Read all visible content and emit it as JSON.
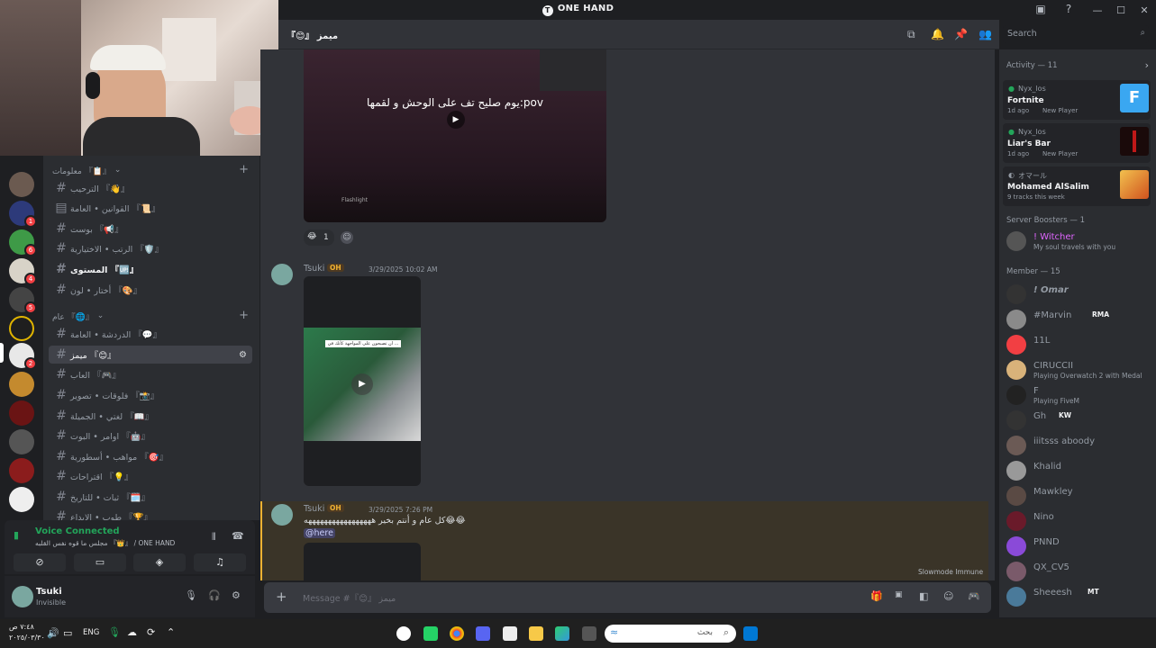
{
  "window": {
    "title": "ONE HAND",
    "controls": [
      "—",
      "☐",
      "✕"
    ]
  },
  "header": {
    "channel": "『😊』 ميمز",
    "search_placeholder": "Search"
  },
  "server_badges": [
    "1",
    "6",
    "4",
    "5",
    "2"
  ],
  "sidebar": {
    "categories": [
      {
        "label": "معلومات 『📋』"
      },
      {
        "label": "عام 『🌐』"
      }
    ],
    "channels": [
      {
        "label": "الترحيب 『👋』"
      },
      {
        "label": "القوانين • العامة 『📜』"
      },
      {
        "label": "بوست 『📢』"
      },
      {
        "label": "الرتب • الاختيارية 『🛡️』"
      },
      {
        "label": "المستوى 『🆙』"
      },
      {
        "label": "أختار • لون 『🎨』"
      },
      {
        "label": "الدردشة • العامة 『💬』"
      },
      {
        "label": "ميمز 『😊』"
      },
      {
        "label": "العاب 『🎮』"
      },
      {
        "label": "فلوقات • تصوير 『📸』"
      },
      {
        "label": "لغتي • الجميلة 『📖』"
      },
      {
        "label": "اوامر • البوت 『🤖』"
      },
      {
        "label": "مواهب • أسطورية 『🎯』"
      },
      {
        "label": "اقتراحات 『💡』"
      },
      {
        "label": "ثبات • للتاريخ 『🗓️』"
      },
      {
        "label": "طوب • الابداع 『🏆』"
      }
    ]
  },
  "voice": {
    "status": "Voice Connected",
    "location": "مجلس ما قوه نفس القلبه 『👑』 / ONE HAND"
  },
  "user": {
    "name": "Tsuki",
    "status": "Invisible"
  },
  "messages": [
    {
      "video_caption": "يوم صليح تف على الوحش و لقمها:pov",
      "video_small": "Flashlight",
      "reaction_count": "1"
    },
    {
      "author": "Tsuki",
      "tag": "OH",
      "timestamp": "3/29/2025 10:02 AM",
      "video_caption": "ان تصبحون على المواجهة كأنك في ..."
    },
    {
      "author": "Tsuki",
      "tag": "OH",
      "timestamp": "3/29/2025 7:26 PM",
      "text": "كل عام و أنتم بخير هههههههههههههههههه😂😂",
      "mention": "@here"
    }
  ],
  "slowmode": "Slowmode Immune",
  "input_placeholder": "Message #『😊』 ميمز",
  "activity": {
    "title": "Activity — 11",
    "items": [
      {
        "user": "Nyx_los",
        "game": "Fortnite",
        "meta": "1d ago",
        "tag": "New Player",
        "color": "#3aa7f1"
      },
      {
        "user": "Nyx_los",
        "game": "Liar's Bar",
        "meta": "1d ago",
        "tag": "New Player",
        "color": "#7a0c0c"
      },
      {
        "user": "オマール",
        "game": "Mohamed AlSalim",
        "meta": "9 tracks this week",
        "color": "#d88a2a"
      }
    ]
  },
  "boosters": {
    "title": "Server Boosters — 1",
    "name": "! Witcher",
    "sub": "My soul travels with you"
  },
  "members": {
    "title": "Member — 15",
    "list": [
      {
        "name": "! Omar",
        "sub": ""
      },
      {
        "name": "#Marvin",
        "tag": "RMA",
        "sub": ""
      },
      {
        "name": "11L",
        "sub": ""
      },
      {
        "name": "CIRUCCII",
        "sub": "Playing Overwatch 2 with Medal"
      },
      {
        "name": "F",
        "sub": "Playing FiveM"
      },
      {
        "name": "Gh",
        "tag": "KW",
        "sub": ""
      },
      {
        "name": "iiitsss aboody",
        "sub": ""
      },
      {
        "name": "Khalid",
        "sub": ""
      },
      {
        "name": "Mawkley",
        "sub": ""
      },
      {
        "name": "Nino",
        "sub": ""
      },
      {
        "name": "PNND",
        "sub": ""
      },
      {
        "name": "QX_CV5",
        "sub": ""
      },
      {
        "name": "Sheeesh",
        "tag": "MT",
        "sub": ""
      }
    ]
  },
  "taskbar": {
    "lang": "ENG",
    "time": "٧:٤٨ ص",
    "date": "٢٠٢٥/٠٣/٣٠",
    "search_placeholder": "بحث"
  }
}
